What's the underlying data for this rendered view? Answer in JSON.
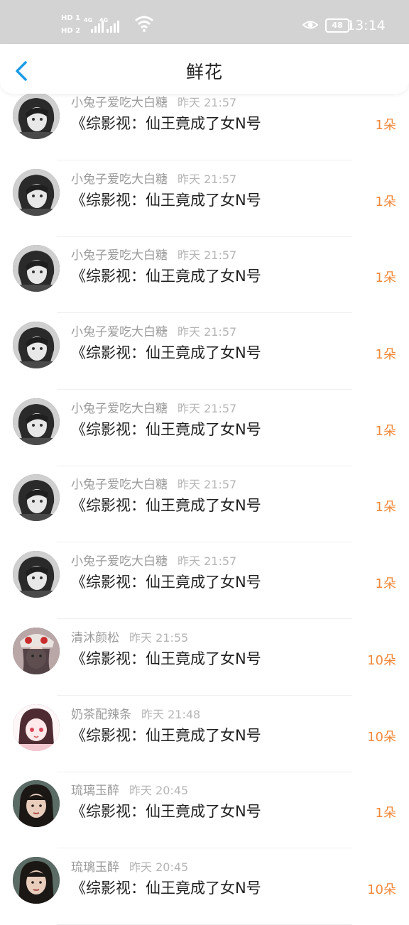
{
  "status_bar": {
    "hd1": "HD 1",
    "hd2": "HD 2",
    "sig1": "4G",
    "sig2": "4G",
    "battery": "48",
    "time": "13:14"
  },
  "nav": {
    "title": "鲜花"
  },
  "colors": {
    "accent": "#1d9be6",
    "count": "#f0883a",
    "status_bg": "#d3d3d3"
  },
  "records": [
    {
      "user": "小兔子爱吃大白糖",
      "time": "昨天 21:57",
      "book": "《综影视：仙王竟成了女N号",
      "count": "1朵",
      "avatar": "dark-hair-portrait"
    },
    {
      "user": "小兔子爱吃大白糖",
      "time": "昨天 21:57",
      "book": "《综影视：仙王竟成了女N号",
      "count": "1朵",
      "avatar": "dark-hair-portrait"
    },
    {
      "user": "小兔子爱吃大白糖",
      "time": "昨天 21:57",
      "book": "《综影视：仙王竟成了女N号",
      "count": "1朵",
      "avatar": "dark-hair-portrait"
    },
    {
      "user": "小兔子爱吃大白糖",
      "time": "昨天 21:57",
      "book": "《综影视：仙王竟成了女N号",
      "count": "1朵",
      "avatar": "dark-hair-portrait"
    },
    {
      "user": "小兔子爱吃大白糖",
      "time": "昨天 21:57",
      "book": "《综影视：仙王竟成了女N号",
      "count": "1朵",
      "avatar": "dark-hair-portrait"
    },
    {
      "user": "小兔子爱吃大白糖",
      "time": "昨天 21:57",
      "book": "《综影视：仙王竟成了女N号",
      "count": "1朵",
      "avatar": "dark-hair-portrait"
    },
    {
      "user": "小兔子爱吃大白糖",
      "time": "昨天 21:57",
      "book": "《综影视：仙王竟成了女N号",
      "count": "1朵",
      "avatar": "dark-hair-portrait"
    },
    {
      "user": "清沐颜松",
      "time": "昨天 21:55",
      "book": "《综影视：仙王竟成了女N号",
      "count": "10朵",
      "avatar": "girl-hat-portrait"
    },
    {
      "user": "奶茶配辣条",
      "time": "昨天 21:48",
      "book": "《综影视：仙王竟成了女N号",
      "count": "10朵",
      "avatar": "anime-girl-portrait"
    },
    {
      "user": "琉璃玉醉",
      "time": "昨天 20:45",
      "book": "《综影视：仙王竟成了女N号",
      "count": "1朵",
      "avatar": "woman-portrait"
    },
    {
      "user": "琉璃玉醉",
      "time": "昨天 20:45",
      "book": "《综影视：仙王竟成了女N号",
      "count": "10朵",
      "avatar": "woman-portrait"
    }
  ]
}
